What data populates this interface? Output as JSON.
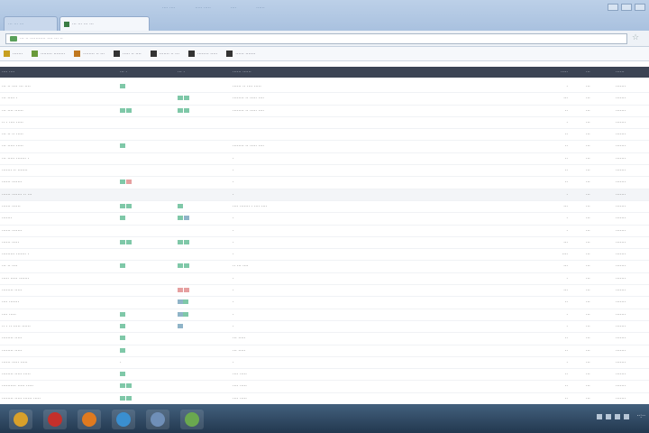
{
  "browser": {
    "tabs": [
      {
        "label": "··· ··· ···",
        "active": false
      },
      {
        "label": "··· ··· ··· ···",
        "active": true
      }
    ],
    "top_links": [
      "···· ····",
      "····· ·····",
      "····",
      "······"
    ],
    "address": "··· ·· ··········· ···· ··· ··",
    "bookmarks": [
      {
        "label": "·······",
        "icon": "folder-icon"
      },
      {
        "label": "········ ········",
        "icon": "page-icon"
      },
      {
        "label": "········ ·· ···",
        "icon": "page-icon"
      },
      {
        "label": "····· ·· ····",
        "icon": "page-icon"
      },
      {
        "label": "······· ·· ···",
        "icon": "page-icon"
      },
      {
        "label": "········ ·····",
        "icon": "page-icon"
      },
      {
        "label": "······ ·······",
        "icon": "page-icon"
      }
    ]
  },
  "table": {
    "headers": [
      "···· ····",
      "··· ·",
      "··· ·",
      "······ ······",
      "·····",
      "···",
      "······"
    ],
    "rows": [
      {
        "name": "··· ·· ···· ··· ····",
        "c1": "g",
        "c2": "",
        "desc": "······ ·· ···· ·····",
        "num": "·",
        "code": "···",
        "status": "·······"
      },
      {
        "name": "··· ····· ·",
        "c1": "",
        "c2": "gg",
        "desc": "········ ·· ····· ····",
        "num": "···",
        "code": "···",
        "status": "·······"
      },
      {
        "name": "··· ···· ······",
        "c1": "gg",
        "c2": "gg",
        "desc": "········ ·· ····· ····",
        "num": "··",
        "code": "···",
        "status": "·······"
      },
      {
        "name": "·· · ···· ·····",
        "c1": "",
        "c2": "",
        "desc": "",
        "num": "·",
        "code": "···",
        "status": "·······"
      },
      {
        "name": "··· ·· ·· ·····",
        "c1": "",
        "c2": "",
        "desc": "",
        "num": "··",
        "code": "···",
        "status": "·······"
      },
      {
        "name": "··· ····· ·····",
        "c1": "g",
        "c2": "",
        "desc": "········ ·· ····· ····",
        "num": "··",
        "code": "···",
        "status": "·······"
      },
      {
        "name": "··· ····· ······· ·",
        "c1": "",
        "c2": "",
        "desc": "·",
        "num": "··",
        "code": "···",
        "status": "·······"
      },
      {
        "name": "······· ·· ·······",
        "c1": "",
        "c2": "",
        "desc": "·",
        "num": "··",
        "code": "···",
        "status": "·······"
      },
      {
        "name": "······ ·······",
        "c1": "gr",
        "c2": "",
        "desc": "·",
        "num": "··",
        "code": "···",
        "status": "·······"
      },
      {
        "name": "······ ······· ·· ···",
        "c1": "",
        "c2": "",
        "desc": "·",
        "num": "·",
        "code": "···",
        "status": "·······"
      },
      {
        "name": "······ ······",
        "c1": "gg",
        "c2": "g",
        "desc": "···· ······· · ···· ····",
        "num": "···",
        "code": "···",
        "status": "·······"
      },
      {
        "name": "·······",
        "c1": "g",
        "c2": "gb",
        "desc": "·",
        "num": "·",
        "code": "···",
        "status": "·······"
      },
      {
        "name": "······ ·······",
        "c1": "",
        "c2": "",
        "desc": "·",
        "num": "·",
        "code": "···",
        "status": "·······"
      },
      {
        "name": "······ ·····",
        "c1": "gg",
        "c2": "gg",
        "desc": "·",
        "num": "···",
        "code": "···",
        "status": "·······"
      },
      {
        "name": "········· ······· ·",
        "c1": "",
        "c2": "",
        "desc": "·",
        "num": "····",
        "code": "···",
        "status": "·······"
      },
      {
        "name": "··· ·· ····",
        "c1": "g",
        "c2": "gg",
        "desc": "·· ··· ····",
        "num": "···",
        "code": "···",
        "status": "·······"
      },
      {
        "name": "····· ····· ·······",
        "c1": "",
        "c2": "",
        "desc": "·",
        "num": "·",
        "code": "···",
        "status": "·······"
      },
      {
        "name": "········ ·····",
        "c1": "",
        "c2": "rr",
        "desc": "·",
        "num": "···",
        "code": "···",
        "status": "·······"
      },
      {
        "name": "···· ·······",
        "c1": "",
        "c2": "bg",
        "desc": "·",
        "num": "··",
        "code": "···",
        "status": "·······"
      },
      {
        "name": "···· ·····",
        "c1": "g",
        "c2": "bg",
        "desc": "·",
        "num": "·",
        "code": "···",
        "status": "·······"
      },
      {
        "name": "·· · ·· ····· ······",
        "c1": "g",
        "c2": "b",
        "desc": "·",
        "num": "·",
        "code": "···",
        "status": "·······"
      },
      {
        "name": "········ ·····",
        "c1": "g",
        "c2": "",
        "desc": "··· ·····",
        "num": "··",
        "code": "···",
        "status": "·······"
      },
      {
        "name": "········ ·····",
        "c1": "g",
        "c2": "",
        "desc": "··· ·····",
        "num": "··",
        "code": "···",
        "status": "·······"
      },
      {
        "name": "······ ····· ·····",
        "c1": "·",
        "c2": "",
        "desc": "·",
        "num": "·",
        "code": "···",
        "status": "·······"
      },
      {
        "name": "········ ····· ·····",
        "c1": "g",
        "c2": "",
        "desc": "···· ·····",
        "num": "··",
        "code": "···",
        "status": "·······"
      },
      {
        "name": "·········· ····· ·····",
        "c1": "gg",
        "c2": "",
        "desc": "···· ·····",
        "num": "··",
        "code": "···",
        "status": "·······"
      },
      {
        "name": "········ ····· ······ ·····",
        "c1": "gg",
        "c2": "",
        "desc": "···· ·····",
        "num": "··",
        "code": "···",
        "status": "·······"
      }
    ]
  },
  "taskbar": {
    "apps": [
      {
        "icon": "chrome-icon",
        "color": "#d9a02a"
      },
      {
        "icon": "opera-icon",
        "color": "#c4302b"
      },
      {
        "icon": "firefox-icon",
        "color": "#e07a1f"
      },
      {
        "icon": "explorer-icon",
        "color": "#3a8fd0"
      },
      {
        "icon": "window-icon",
        "color": "#6f8fb8"
      },
      {
        "icon": "document-icon",
        "color": "#6aa84f"
      }
    ],
    "clock": "··:··"
  }
}
